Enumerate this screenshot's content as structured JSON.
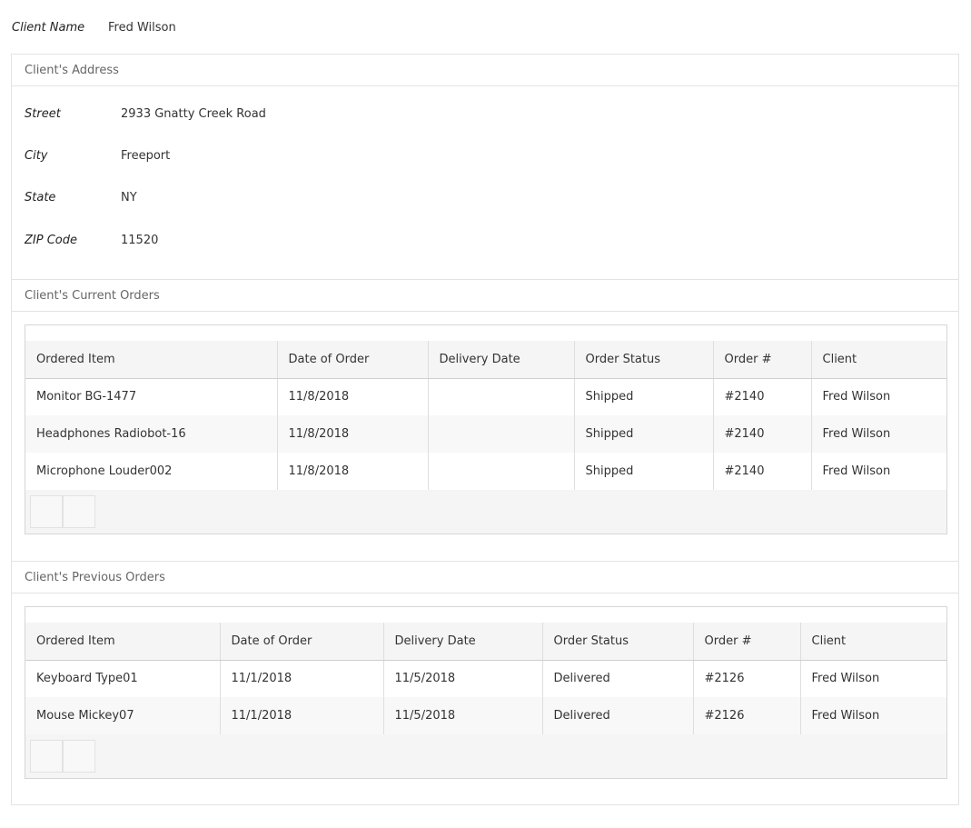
{
  "client": {
    "label": "Client Name",
    "value": "Fred Wilson"
  },
  "address": {
    "header": "Client's Address",
    "fields": [
      {
        "label": "Street",
        "value": "2933 Gnatty Creek Road"
      },
      {
        "label": "City",
        "value": "Freeport"
      },
      {
        "label": "State",
        "value": "NY"
      },
      {
        "label": "ZIP Code",
        "value": "11520"
      }
    ]
  },
  "current_orders": {
    "header": "Client's Current Orders",
    "columns": [
      "Ordered Item",
      "Date of Order",
      "Delivery Date",
      "Order Status",
      "Order #",
      "Client"
    ],
    "rows": [
      [
        "Monitor BG-1477",
        "11/8/2018",
        "",
        "Shipped",
        "#2140",
        "Fred Wilson"
      ],
      [
        "Headphones Radiobot-16",
        "11/8/2018",
        "",
        "Shipped",
        "#2140",
        "Fred Wilson"
      ],
      [
        "Microphone Louder002",
        "11/8/2018",
        "",
        "Shipped",
        "#2140",
        "Fred Wilson"
      ]
    ]
  },
  "previous_orders": {
    "header": "Client's Previous Orders",
    "columns": [
      "Ordered Item",
      "Date of Order",
      "Delivery Date",
      "Order Status",
      "Order #",
      "Client"
    ],
    "rows": [
      [
        "Keyboard Type01",
        "11/1/2018",
        "11/5/2018",
        "Delivered",
        "#2126",
        "Fred Wilson"
      ],
      [
        "Mouse Mickey07",
        "11/1/2018",
        "11/5/2018",
        "Delivered",
        "#2126",
        "Fred Wilson"
      ]
    ]
  }
}
